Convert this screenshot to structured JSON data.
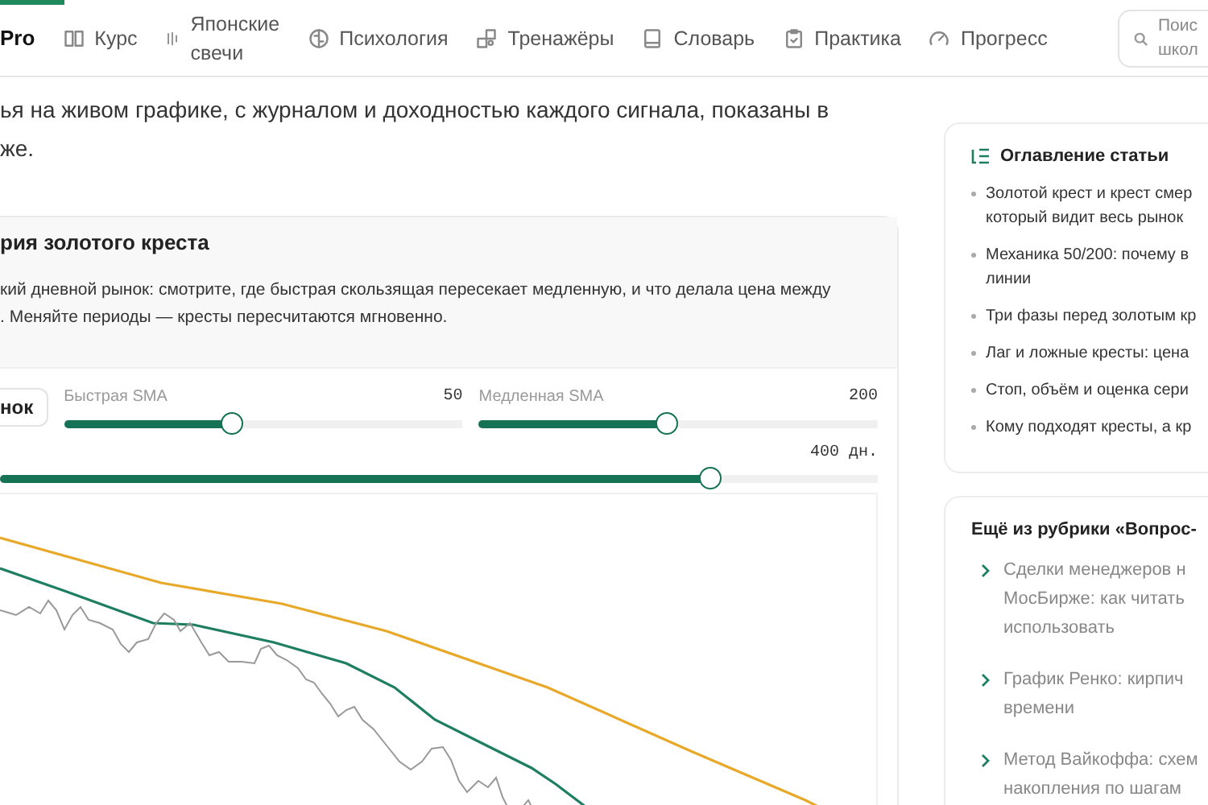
{
  "nav": {
    "brand": "Pro",
    "items": [
      {
        "label": "Курс"
      },
      {
        "label": "Японские\nсвечи"
      },
      {
        "label": "Психология"
      },
      {
        "label": "Тренажёры"
      },
      {
        "label": "Словарь"
      },
      {
        "label": "Практика"
      },
      {
        "label": "Прогресс"
      }
    ],
    "search": {
      "placeholder": "Поис\nшкол"
    }
  },
  "intro": "ья на живом графике, с журналом и доходностью каждого сигнала, показаны в\nже.",
  "widget": {
    "title": "рия золотого креста",
    "description": "кий дневной рынок: смотрите, где быстрая скользящая пересекает медленную, и что делала цена между\n. Меняйте периоды — кресты пересчитаются мгновенно.",
    "button": "нок",
    "sliders": [
      {
        "label": "Быстрая SMA",
        "reading": "50",
        "level": 0.42
      },
      {
        "label": "Медленная SMA",
        "reading": "200",
        "level": 0.47
      }
    ],
    "period": {
      "reading": "400 дн.",
      "level": 0.81
    }
  },
  "toc": {
    "title": "Оглавление статьи",
    "items": [
      "Золотой крест и крест смер\nкоторый видит весь рынок",
      "Механика 50/200: почему в\nлинии",
      "Три фазы перед золотым кр",
      "Лаг и ложные кресты: цена",
      "Стоп, объём и оценка сери",
      "Кому подходят кресты, а кр"
    ]
  },
  "more": {
    "title": "Ещё из рубрики «Вопрос-",
    "items": [
      "Сделки менеджеров н\nМосБирже: как читать\nиспользовать",
      "График Ренко: кирпич\nвремени",
      "Метод Вайкоффа: схем\nнакопления по шагам"
    ]
  }
}
